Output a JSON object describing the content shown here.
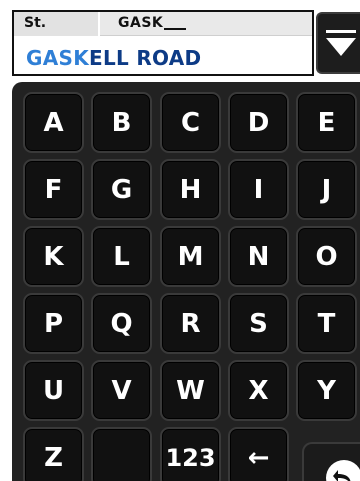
{
  "entry": {
    "type_label": "St.",
    "typed_text": "GASK",
    "suggestion_match": "GASK",
    "suggestion_rest": "ELL ROAD"
  },
  "controls": {
    "dropdown_icon": "dropdown-icon",
    "back_icon": "back-icon"
  },
  "keyboard": {
    "row1": [
      "A",
      "B",
      "C",
      "D",
      "E"
    ],
    "row2": [
      "F",
      "G",
      "H",
      "I",
      "J"
    ],
    "row3": [
      "K",
      "L",
      "M",
      "N",
      "O"
    ],
    "row4": [
      "P",
      "Q",
      "R",
      "S",
      "T"
    ],
    "row5": [
      "U",
      "V",
      "W",
      "X",
      "Y"
    ],
    "row6_letter": "Z",
    "row6_blank": "",
    "numbers_label": "123",
    "backspace_glyph": "←"
  },
  "colors": {
    "suggestion_match": "#2f7fd6",
    "suggestion_rest": "#0d3b86",
    "keyboard_bg": "#222222",
    "key_bg": "#111111"
  }
}
